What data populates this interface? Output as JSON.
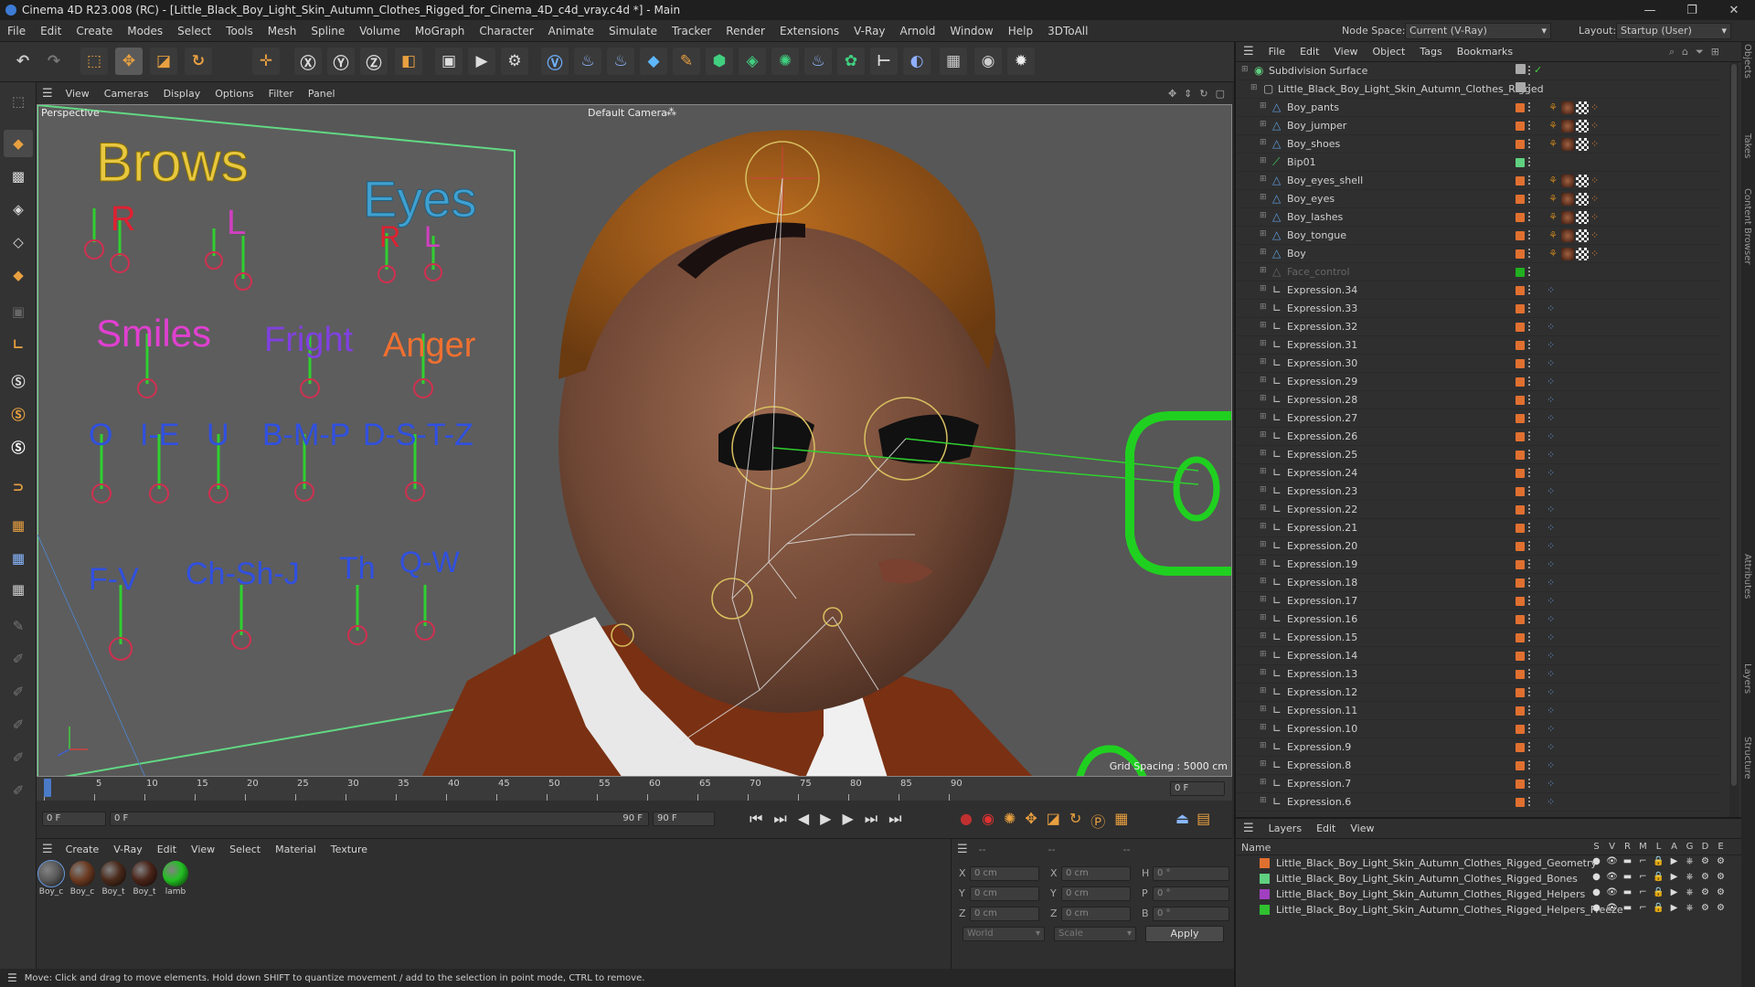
{
  "window": {
    "title": "Cinema 4D R23.008 (RC) - [Little_Black_Boy_Light_Skin_Autumn_Clothes_Rigged_for_Cinema_4D_c4d_vray.c4d *] - Main",
    "minimize": "—",
    "maximize": "❐",
    "close": "✕"
  },
  "menu": [
    "File",
    "Edit",
    "Create",
    "Modes",
    "Select",
    "Tools",
    "Mesh",
    "Spline",
    "Volume",
    "MoGraph",
    "Character",
    "Animate",
    "Simulate",
    "Tracker",
    "Render",
    "Extensions",
    "V-Ray",
    "Arnold",
    "Window",
    "Help",
    "3DToAll"
  ],
  "node_space": {
    "label": "Node Space:",
    "value": "Current (V-Ray)"
  },
  "layout": {
    "label": "Layout:",
    "value": "Startup (User)"
  },
  "viewport": {
    "menu": [
      "View",
      "Cameras",
      "Display",
      "Options",
      "Filter",
      "Panel"
    ],
    "label": "Perspective",
    "camera": "Default Camera",
    "grid_spacing": "Grid Spacing : 5000 cm",
    "face_labels": {
      "brows": "Brows",
      "eyes": "Eyes",
      "r": "R",
      "l": "L",
      "r2": "R",
      "l2": "L",
      "smiles": "Smiles",
      "fright": "Fright",
      "anger": "Anger",
      "o": "O",
      "ie": "I-E",
      "u": "U",
      "bmp": "B-M-P",
      "dstz": "D-S-T-Z",
      "fv": "F-V",
      "chshj": "Ch-Sh-J",
      "th": "Th",
      "qw": "Q-W"
    }
  },
  "timeline": {
    "ticks": [
      "0",
      "5",
      "10",
      "15",
      "20",
      "25",
      "30",
      "35",
      "40",
      "45",
      "50",
      "55",
      "60",
      "65",
      "70",
      "75",
      "80",
      "85",
      "90"
    ],
    "current_frame": "0 F"
  },
  "transport": {
    "start": "0 F",
    "pos": "0 F",
    "end_a": "90 F",
    "end_b": "90 F"
  },
  "materials": {
    "menu": [
      "Create",
      "V-Ray",
      "Edit",
      "View",
      "Select",
      "Material",
      "Texture"
    ],
    "items": [
      {
        "label": "Boy_c",
        "color": "#5a5a5a"
      },
      {
        "label": "Boy_c",
        "color": "#6b3a20"
      },
      {
        "label": "Boy_t",
        "color": "#4a2a1a"
      },
      {
        "label": "Boy_t",
        "color": "#4a2418"
      },
      {
        "label": "lamb",
        "color": "#22c022"
      }
    ]
  },
  "attributes": {
    "header": "--",
    "header2": "--",
    "header3": "--",
    "rows": [
      {
        "a": "X",
        "av": "0 cm",
        "b": "X",
        "bv": "0 cm",
        "c": "H",
        "cv": "0 °"
      },
      {
        "a": "Y",
        "av": "0 cm",
        "b": "Y",
        "bv": "0 cm",
        "c": "P",
        "cv": "0 °"
      },
      {
        "a": "Z",
        "av": "0 cm",
        "b": "Z",
        "bv": "0 cm",
        "c": "B",
        "cv": "0 °"
      }
    ],
    "coord": "World",
    "mode": "Scale",
    "apply": "Apply"
  },
  "objects": {
    "menu": [
      "File",
      "Edit",
      "View",
      "Object",
      "Tags",
      "Bookmarks"
    ],
    "items": [
      {
        "name": "Subdivision Surface",
        "indent": 0,
        "color": "",
        "kind": "subd"
      },
      {
        "name": "Little_Black_Boy_Light_Skin_Autumn_Clothes_Rigged",
        "indent": 1,
        "color": "",
        "kind": "null"
      },
      {
        "name": "Boy_pants",
        "indent": 2,
        "color": "#e07030",
        "kind": "mesh"
      },
      {
        "name": "Boy_jumper",
        "indent": 2,
        "color": "#e07030",
        "kind": "mesh"
      },
      {
        "name": "Boy_shoes",
        "indent": 2,
        "color": "#e07030",
        "kind": "mesh"
      },
      {
        "name": "Bip01",
        "indent": 2,
        "color": "#60d080",
        "kind": "bone"
      },
      {
        "name": "Boy_eyes_shell",
        "indent": 2,
        "color": "#e07030",
        "kind": "mesh"
      },
      {
        "name": "Boy_eyes",
        "indent": 2,
        "color": "#e07030",
        "kind": "mesh"
      },
      {
        "name": "Boy_lashes",
        "indent": 2,
        "color": "#e07030",
        "kind": "mesh"
      },
      {
        "name": "Boy_tongue",
        "indent": 2,
        "color": "#e07030",
        "kind": "mesh"
      },
      {
        "name": "Boy",
        "indent": 2,
        "color": "#e07030",
        "kind": "mesh"
      },
      {
        "name": "Face_control",
        "indent": 2,
        "color": "#20b020",
        "kind": "dim"
      },
      {
        "name": "Expression.34",
        "indent": 2,
        "color": "#e07030",
        "kind": "expr"
      },
      {
        "name": "Expression.33",
        "indent": 2,
        "color": "#e07030",
        "kind": "expr"
      },
      {
        "name": "Expression.32",
        "indent": 2,
        "color": "#e07030",
        "kind": "expr"
      },
      {
        "name": "Expression.31",
        "indent": 2,
        "color": "#e07030",
        "kind": "expr"
      },
      {
        "name": "Expression.30",
        "indent": 2,
        "color": "#e07030",
        "kind": "expr"
      },
      {
        "name": "Expression.29",
        "indent": 2,
        "color": "#e07030",
        "kind": "expr"
      },
      {
        "name": "Expression.28",
        "indent": 2,
        "color": "#e07030",
        "kind": "expr"
      },
      {
        "name": "Expression.27",
        "indent": 2,
        "color": "#e07030",
        "kind": "expr"
      },
      {
        "name": "Expression.26",
        "indent": 2,
        "color": "#e07030",
        "kind": "expr"
      },
      {
        "name": "Expression.25",
        "indent": 2,
        "color": "#e07030",
        "kind": "expr"
      },
      {
        "name": "Expression.24",
        "indent": 2,
        "color": "#e07030",
        "kind": "expr"
      },
      {
        "name": "Expression.23",
        "indent": 2,
        "color": "#e07030",
        "kind": "expr"
      },
      {
        "name": "Expression.22",
        "indent": 2,
        "color": "#e07030",
        "kind": "expr"
      },
      {
        "name": "Expression.21",
        "indent": 2,
        "color": "#e07030",
        "kind": "expr"
      },
      {
        "name": "Expression.20",
        "indent": 2,
        "color": "#e07030",
        "kind": "expr"
      },
      {
        "name": "Expression.19",
        "indent": 2,
        "color": "#e07030",
        "kind": "expr"
      },
      {
        "name": "Expression.18",
        "indent": 2,
        "color": "#e07030",
        "kind": "expr"
      },
      {
        "name": "Expression.17",
        "indent": 2,
        "color": "#e07030",
        "kind": "expr"
      },
      {
        "name": "Expression.16",
        "indent": 2,
        "color": "#e07030",
        "kind": "expr"
      },
      {
        "name": "Expression.15",
        "indent": 2,
        "color": "#e07030",
        "kind": "expr"
      },
      {
        "name": "Expression.14",
        "indent": 2,
        "color": "#e07030",
        "kind": "expr"
      },
      {
        "name": "Expression.13",
        "indent": 2,
        "color": "#e07030",
        "kind": "expr"
      },
      {
        "name": "Expression.12",
        "indent": 2,
        "color": "#e07030",
        "kind": "expr"
      },
      {
        "name": "Expression.11",
        "indent": 2,
        "color": "#e07030",
        "kind": "expr"
      },
      {
        "name": "Expression.10",
        "indent": 2,
        "color": "#e07030",
        "kind": "expr"
      },
      {
        "name": "Expression.9",
        "indent": 2,
        "color": "#e07030",
        "kind": "expr"
      },
      {
        "name": "Expression.8",
        "indent": 2,
        "color": "#e07030",
        "kind": "expr"
      },
      {
        "name": "Expression.7",
        "indent": 2,
        "color": "#e07030",
        "kind": "expr"
      },
      {
        "name": "Expression.6",
        "indent": 2,
        "color": "#e07030",
        "kind": "expr"
      }
    ]
  },
  "layers": {
    "menu": [
      "Layers",
      "Edit",
      "View"
    ],
    "name_header": "Name",
    "flags": [
      "S",
      "V",
      "R",
      "M",
      "L",
      "A",
      "G",
      "D",
      "E"
    ],
    "items": [
      {
        "name": "Little_Black_Boy_Light_Skin_Autumn_Clothes_Rigged_Geometry",
        "color": "#e07030"
      },
      {
        "name": "Little_Black_Boy_Light_Skin_Autumn_Clothes_Rigged_Bones",
        "color": "#60d080"
      },
      {
        "name": "Little_Black_Boy_Light_Skin_Autumn_Clothes_Rigged_Helpers",
        "color": "#a040c0"
      },
      {
        "name": "Little_Black_Boy_Light_Skin_Autumn_Clothes_Rigged_Helpers_Freeze",
        "color": "#30c030"
      }
    ]
  },
  "side_tabs": [
    "Objects",
    "Takes",
    "Content Browser",
    "Attributes",
    "Layers",
    "Structure"
  ],
  "status": "Move: Click and drag to move elements. Hold down SHIFT to quantize movement / add to the selection in point mode, CTRL to remove."
}
